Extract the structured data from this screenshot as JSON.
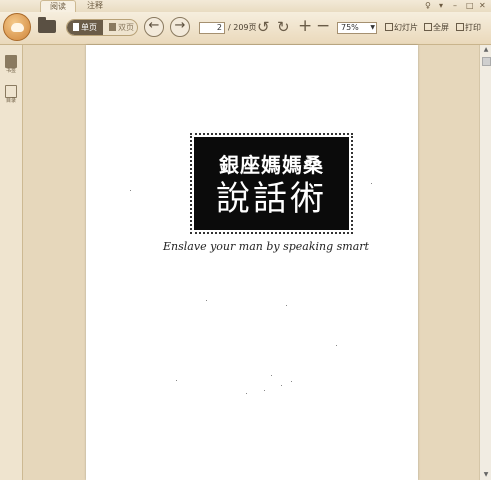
{
  "tabs": [
    {
      "label": "阅读",
      "active": true
    },
    {
      "label": "注释",
      "active": false
    }
  ],
  "toolbar": {
    "view_single_label": "单页",
    "view_double_label": "双页",
    "current_page": "2",
    "total_pages_label": "/ 209页",
    "zoom": "75%",
    "slideshow_label": "幻灯片",
    "fullscreen_label": "全屏",
    "print_label": "打印",
    "icons": {
      "prev": "arrow-left-icon",
      "next": "arrow-right-icon",
      "rotate_left": "rotate-left-icon",
      "rotate_right": "rotate-right-icon",
      "zoom_in": "plus-icon",
      "zoom_out": "minus-icon"
    }
  },
  "sidebar": {
    "items": [
      {
        "label": "书签",
        "icon": "bookmark-icon"
      },
      {
        "label": "目录",
        "icon": "toc-icon"
      }
    ]
  },
  "document": {
    "title_line1": "銀座媽媽桑",
    "title_line2": "說話術",
    "subtitle": "Enslave your man by speaking smart"
  },
  "colors": {
    "toolbar_bg": "#f0e4cc",
    "canvas_bg": "#e6d7bb",
    "accent_dark": "#6a5c48"
  }
}
